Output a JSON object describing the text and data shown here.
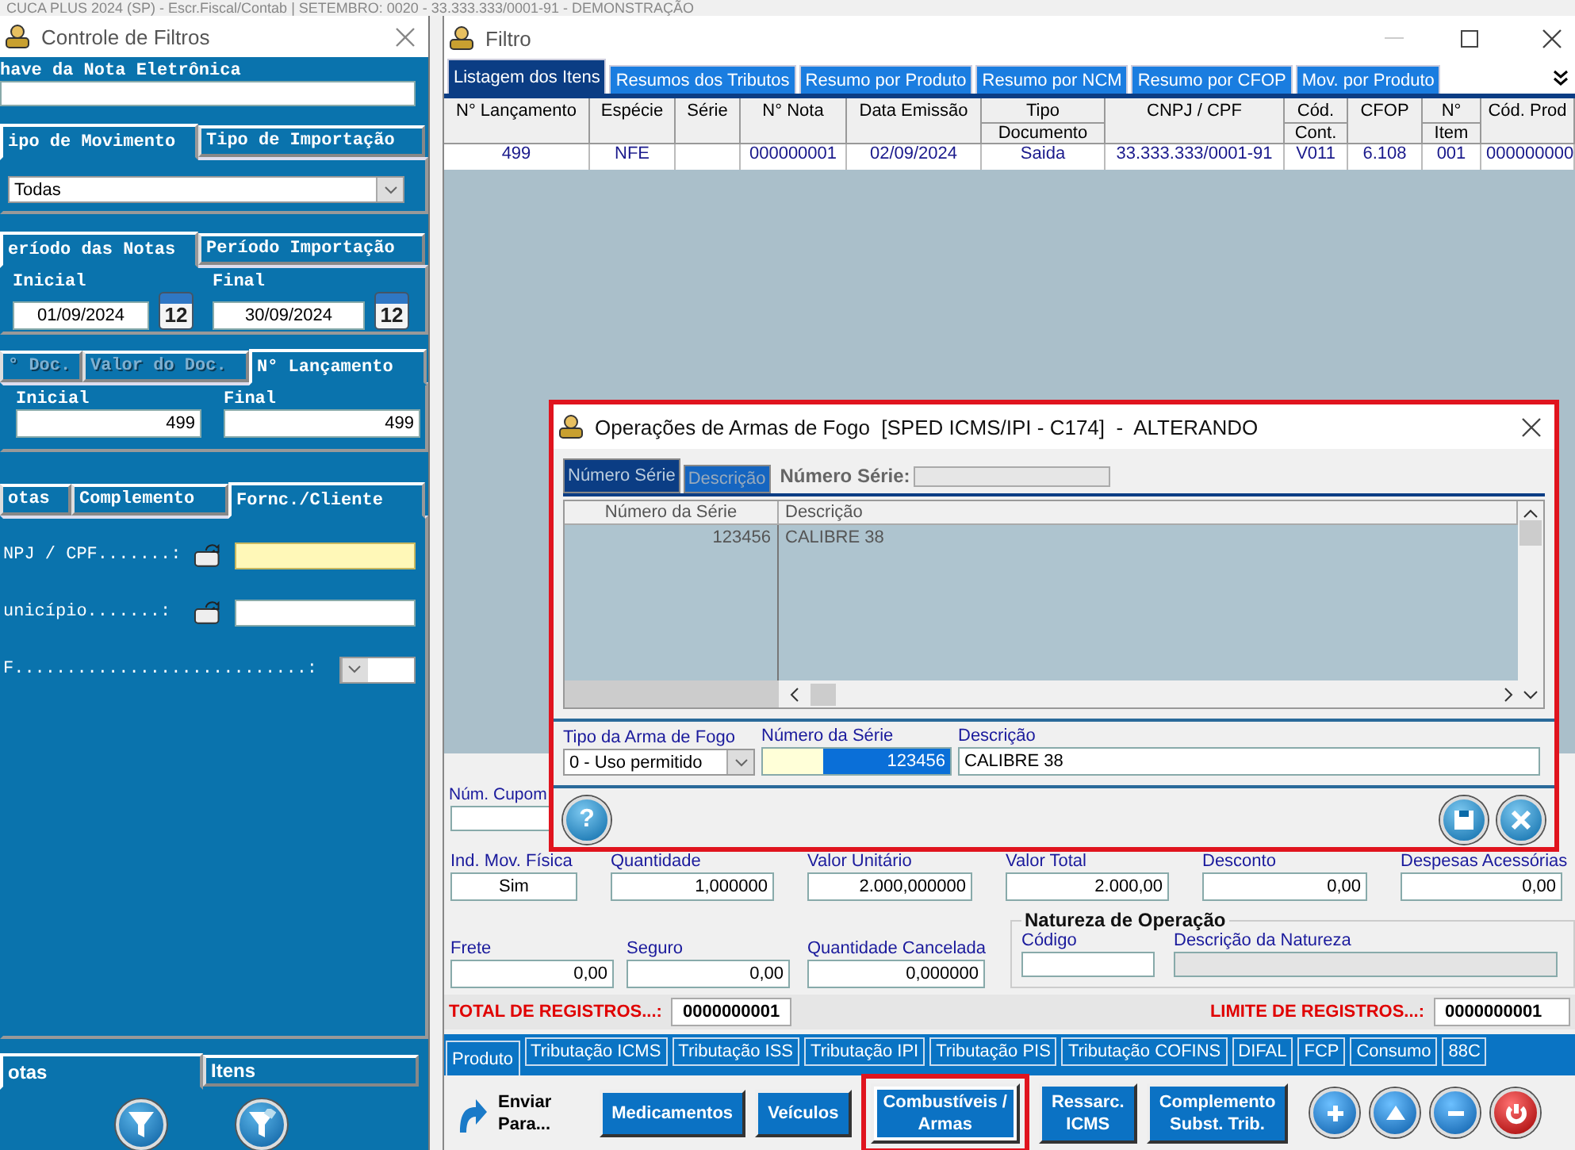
{
  "background_title": "CUCA PLUS 2024 (SP) - Escr.Fiscal/Contab | SETEMBRO: 0020 - 33.333.333/0001-91 - DEMONSTRAÇÃO",
  "filter_panel": {
    "title": "Controle de Filtros",
    "key_label": "have da Nota Eletrônica",
    "movement_tabs": [
      {
        "label": "ipo de Movimento",
        "selected": true
      },
      {
        "label": "Tipo de Importação",
        "selected": false
      }
    ],
    "movement_value": "Todas",
    "period_tabs": [
      {
        "label": "eríodo das Notas",
        "selected": true
      },
      {
        "label": "Período Importação",
        "selected": false
      }
    ],
    "period": {
      "start_label": "Inicial",
      "start": "01/09/2024",
      "start_calendar": "12",
      "end_label": "Final",
      "end": "30/09/2024",
      "end_calendar": "12"
    },
    "doc_tabs": [
      {
        "label": "° Doc.",
        "selected": false,
        "disabled": true
      },
      {
        "label": "Valor do Doc.",
        "selected": false,
        "disabled": true
      },
      {
        "label": "N° Lançamento",
        "selected": true,
        "disabled": false
      }
    ],
    "entry_range": {
      "start_label": "Inicial",
      "start": "499",
      "end_label": "Final",
      "end": "499"
    },
    "detail_tabs": [
      {
        "label": "otas",
        "selected": false
      },
      {
        "label": "Complemento",
        "selected": false
      },
      {
        "label": "Fornc./Cliente",
        "selected": true
      }
    ],
    "detail_fields": [
      {
        "label": "NPJ / CPF.......:",
        "kind": "lookup",
        "focused": true
      },
      {
        "label": "unicípio.......:",
        "kind": "lookup",
        "focused": false
      },
      {
        "label": "F............................:",
        "kind": "select"
      }
    ],
    "bottom_tabs": [
      {
        "label": "otas",
        "selected": true
      },
      {
        "label": "Itens",
        "selected": false
      }
    ]
  },
  "window": {
    "title": "Filtro"
  },
  "tabs": [
    {
      "label": "Listagem dos Itens",
      "selected": true
    },
    {
      "label": "Resumos dos Tributos",
      "selected": false
    },
    {
      "label": "Resumo por Produto",
      "selected": false
    },
    {
      "label": "Resumo por NCM",
      "selected": false
    },
    {
      "label": "Resumo por CFOP",
      "selected": false
    },
    {
      "label": "Mov. por Produto",
      "selected": false
    }
  ],
  "table": {
    "columns": [
      {
        "label": "N° Lançamento"
      },
      {
        "label": "Espécie"
      },
      {
        "label": "Série"
      },
      {
        "label": "N° Nota"
      },
      {
        "label": "Data Emissão"
      },
      {
        "label": "Tipo",
        "sub": "Documento"
      },
      {
        "label": "CNPJ / CPF"
      },
      {
        "label": "Cód.",
        "sub": "Cont."
      },
      {
        "label": "CFOP"
      },
      {
        "label": "N°",
        "sub": "Item"
      },
      {
        "label": "Cód. Prod"
      }
    ],
    "rows": [
      [
        "499",
        "NFE",
        null,
        "000000001",
        "02/09/2024",
        "Saida",
        "33.333.333/0001-91",
        "V011",
        "6.108",
        "001",
        "000000000"
      ]
    ]
  },
  "dialog": {
    "title": "Operações de Armas de Fogo  [SPED ICMS/IPI - C174]  -  ALTERANDO",
    "highlighted": true,
    "sort_tabs": [
      {
        "label": "Número Série",
        "selected": true
      },
      {
        "label": "Descrição",
        "selected": false
      }
    ],
    "search_label": "Número Série:",
    "grid": {
      "columns": [
        "Número da Série",
        "Descrição"
      ],
      "rows": [
        [
          "123456",
          "CALIBRE 38"
        ]
      ]
    },
    "type_label": "Tipo da Arma de Fogo",
    "type_value": "0 - Uso permitido",
    "serial_label": "Número da Série",
    "serial_value": "123456",
    "desc_label": "Descrição",
    "desc_value": "CALIBRE 38",
    "help_button": "?"
  },
  "cupom_label": "Núm. Cupom",
  "item_fields": [
    {
      "label": "Ind. Mov. Física",
      "value": "Sim"
    },
    {
      "label": "Quantidade",
      "value": "1,000000"
    },
    {
      "label": "Valor Unitário",
      "value": "2.000,000000"
    },
    {
      "label": "Valor Total",
      "value": "2.000,00"
    },
    {
      "label": "Desconto",
      "value": "0,00"
    },
    {
      "label": "Despesas Acessórias",
      "value": "0,00"
    }
  ],
  "item_fields_2": [
    {
      "label": "Frete",
      "value": "0,00"
    },
    {
      "label": "Seguro",
      "value": "0,00"
    },
    {
      "label": "Quantidade Cancelada",
      "value": "0,000000"
    }
  ],
  "nature": {
    "title": "Natureza de Operação",
    "code_label": "Código",
    "desc_label": "Descrição da Natureza"
  },
  "totals": {
    "total_label": "TOTAL DE REGISTROS...:",
    "total": "0000000001",
    "limit_label": "LIMITE DE REGISTROS...:",
    "limit": "0000000001"
  },
  "bottom_tabs": [
    {
      "label": "Produto",
      "selected": true
    },
    {
      "label": "Tributação ICMS",
      "selected": false
    },
    {
      "label": "Tributação ISS",
      "selected": false
    },
    {
      "label": "Tributação IPI",
      "selected": false
    },
    {
      "label": "Tributação PIS",
      "selected": false
    },
    {
      "label": "Tributação COFINS",
      "selected": false
    },
    {
      "label": "DIFAL",
      "selected": false
    },
    {
      "label": "FCP",
      "selected": false
    },
    {
      "label": "Consumo",
      "selected": false
    },
    {
      "label": "88C",
      "selected": false
    }
  ],
  "send": {
    "line1": "Enviar",
    "line2": "Para..."
  },
  "actions": [
    {
      "line1": "Medicamentos",
      "highlighted": false
    },
    {
      "line1": "Veículos",
      "highlighted": false
    },
    {
      "line1": "Combustíveis /",
      "line2": "Armas",
      "highlighted": true
    },
    {
      "line1": "Ressarc.",
      "line2": "ICMS",
      "highlighted": false
    },
    {
      "line1": "Complemento",
      "line2": "Subst. Trib.",
      "highlighted": false
    }
  ],
  "round_buttons": [
    {
      "kind": "add"
    },
    {
      "kind": "up"
    },
    {
      "kind": "remove"
    },
    {
      "kind": "power"
    }
  ]
}
